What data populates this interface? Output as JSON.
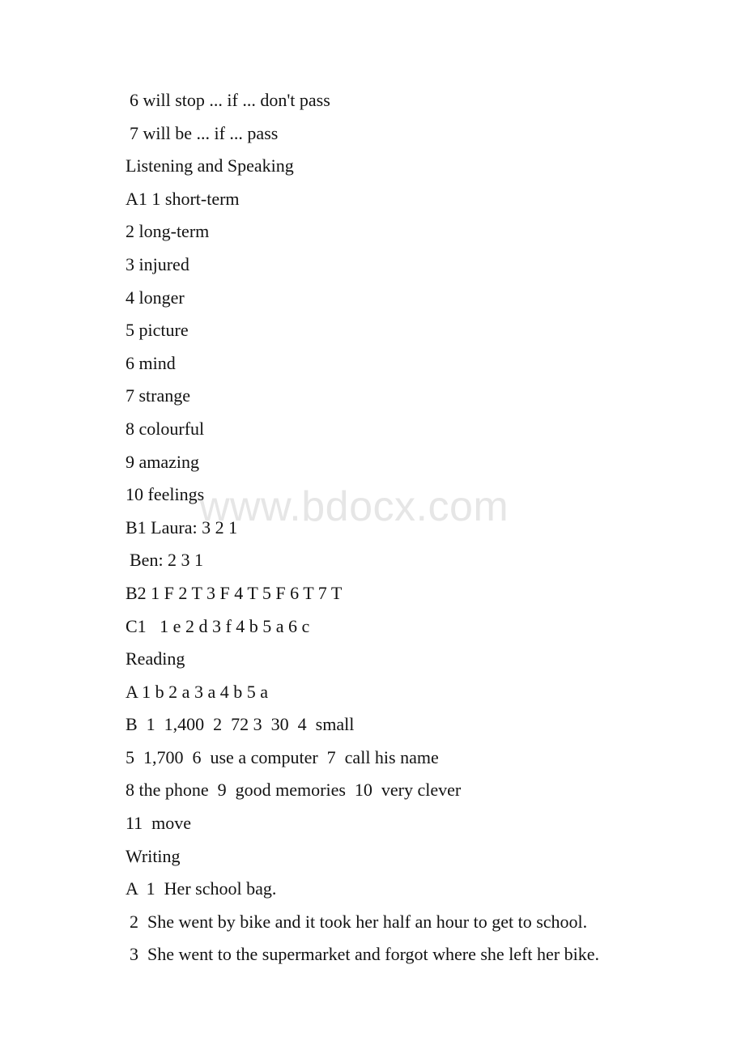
{
  "document": {
    "watermark": "www.bdocx.com",
    "watermark_color": "#e6e6e6",
    "text_color": "#121212",
    "background_color": "#ffffff",
    "lines": [
      {
        "text": "6 will stop ... if ... don't pass",
        "indent": true
      },
      {
        "text": "7 will be ... if ... pass",
        "indent": true
      },
      {
        "text": "Listening and Speaking",
        "indent": false
      },
      {
        "text": "A1 1 short-term",
        "indent": false
      },
      {
        "text": "2 long-term",
        "indent": false
      },
      {
        "text": "3 injured",
        "indent": false
      },
      {
        "text": "4 longer",
        "indent": false
      },
      {
        "text": "5 picture",
        "indent": false
      },
      {
        "text": "6 mind",
        "indent": false
      },
      {
        "text": "7 strange",
        "indent": false
      },
      {
        "text": "8 colourful",
        "indent": false
      },
      {
        "text": "9 amazing",
        "indent": false
      },
      {
        "text": "10 feelings",
        "indent": false
      },
      {
        "text": "B1 Laura: 3 2 1",
        "indent": false
      },
      {
        "text": "Ben: 2 3 1",
        "indent": true
      },
      {
        "text": "B2 1 F 2 T 3 F 4 T 5 F 6 T 7 T",
        "indent": false
      },
      {
        "text": "C1   1 e 2 d 3 f 4 b 5 a 6 c",
        "indent": false
      },
      {
        "text": "Reading",
        "indent": false
      },
      {
        "text": "A 1 b 2 a 3 a 4 b 5 a",
        "indent": false
      },
      {
        "text": "B  1  1,400  2  72 3  30  4  small",
        "indent": false
      },
      {
        "text": "5  1,700  6  use a computer  7  call his name",
        "indent": false
      },
      {
        "text": "8 the phone  9  good memories  10  very clever",
        "indent": false
      },
      {
        "text": "11  move",
        "indent": false
      },
      {
        "text": "Writing",
        "indent": false
      },
      {
        "text": "A  1  Her school bag.",
        "indent": false
      },
      {
        "text": "2  She went by bike and it took her half an hour to get to school.",
        "indent": true
      },
      {
        "text": "3  She went to the supermarket and forgot where she left her bike.",
        "indent": true
      }
    ],
    "sections": [
      "Listening and Speaking",
      "Reading",
      "Writing"
    ]
  }
}
